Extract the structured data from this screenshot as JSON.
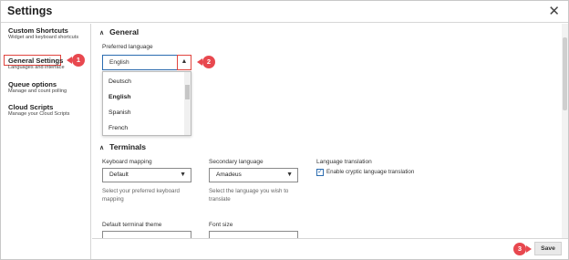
{
  "window": {
    "title": "Settings",
    "close_glyph": "✕"
  },
  "sidebar": {
    "items": [
      {
        "title": "Custom Shortcuts",
        "subtitle": "Widget and keyboard shortcuts"
      },
      {
        "title": "General Settings",
        "subtitle": "Languages and interface"
      },
      {
        "title": "Queue options",
        "subtitle": "Manage and count polling"
      },
      {
        "title": "Cloud Scripts",
        "subtitle": "Manage your Cloud Scripts"
      }
    ]
  },
  "callouts": {
    "one": "1",
    "two": "2",
    "three": "3"
  },
  "general": {
    "heading": "General",
    "preferred_language_label": "Preferred language",
    "preferred_language_value": "English",
    "dropdown_options": [
      "Deutsch",
      "English",
      "Spanish",
      "French"
    ],
    "selected_option": "English"
  },
  "terminals": {
    "heading": "Terminals",
    "keyboard_mapping": {
      "label": "Keyboard mapping",
      "value": "Default",
      "help": "Select your preferred keyboard mapping"
    },
    "secondary_language": {
      "label": "Secondary language",
      "value": "Amadeus",
      "help": "Select the language you wish to translate"
    },
    "language_translation": {
      "label": "Language translation",
      "checkbox_label": "Enable cryptic language translation",
      "checked": true
    },
    "default_terminal_theme": {
      "label": "Default terminal theme"
    },
    "font_size": {
      "label": "Font size"
    }
  },
  "footer": {
    "save_label": "Save"
  },
  "colors": {
    "callout": "#e8484f",
    "highlight": "#e0453f",
    "focus": "#2b6cb0"
  },
  "icons": {
    "chevron_up": "▲",
    "chevron_down": "▼",
    "section_chevron": "∧",
    "check": "✓"
  }
}
